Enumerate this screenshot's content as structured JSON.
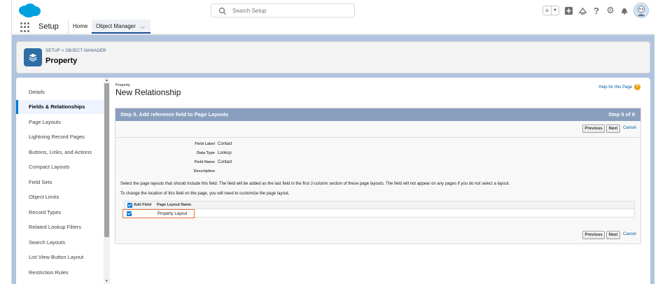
{
  "header": {
    "search_placeholder": "Search Setup"
  },
  "context": {
    "app_name": "Setup",
    "tabs": [
      {
        "label": "Home"
      },
      {
        "label": "Object Manager"
      }
    ]
  },
  "page_header": {
    "breadcrumb": "SETUP > OBJECT MANAGER",
    "title": "Property"
  },
  "sidebar": {
    "items": [
      {
        "label": "Details"
      },
      {
        "label": "Fields & Relationships"
      },
      {
        "label": "Page Layouts"
      },
      {
        "label": "Lightning Record Pages"
      },
      {
        "label": "Buttons, Links, and Actions"
      },
      {
        "label": "Compact Layouts"
      },
      {
        "label": "Field Sets"
      },
      {
        "label": "Object Limits"
      },
      {
        "label": "Record Types"
      },
      {
        "label": "Related Lookup Filters"
      },
      {
        "label": "Search Layouts"
      },
      {
        "label": "List View Button Layout"
      },
      {
        "label": "Restriction Rules"
      }
    ],
    "active_index": 1
  },
  "content": {
    "object_label": "Property",
    "title": "New Relationship",
    "help_link": "Help for this Page",
    "step_title": "Step 5. Add reference field to Page Layouts",
    "step_count": "Step 5 of 6",
    "buttons": {
      "previous": "Previous",
      "next": "Next",
      "cancel": "Cancel"
    },
    "fields": [
      {
        "label": "Field Label",
        "value": "Contact"
      },
      {
        "label": "Data Type",
        "value": "Lookup"
      },
      {
        "label": "Field Name",
        "value": "Contact"
      },
      {
        "label": "Description",
        "value": ""
      }
    ],
    "info_line_1": "Select the page layouts that should include this field. The field will be added as the last field in the first 2-column section of these page layouts. The field will not appear on any pages if you do not select a layout.",
    "info_line_2": "To change the location of this field on the page, you will need to customize the page layout.",
    "table": {
      "col_add_field": "Add Field",
      "col_layout_name": "Page Layout Name",
      "rows": [
        {
          "name": "Property Layout",
          "checked": true
        }
      ]
    }
  },
  "colors": {
    "brand_blue": "#0176d3",
    "wizard_header": "#8a9ebe",
    "highlight": "#e0763a"
  }
}
